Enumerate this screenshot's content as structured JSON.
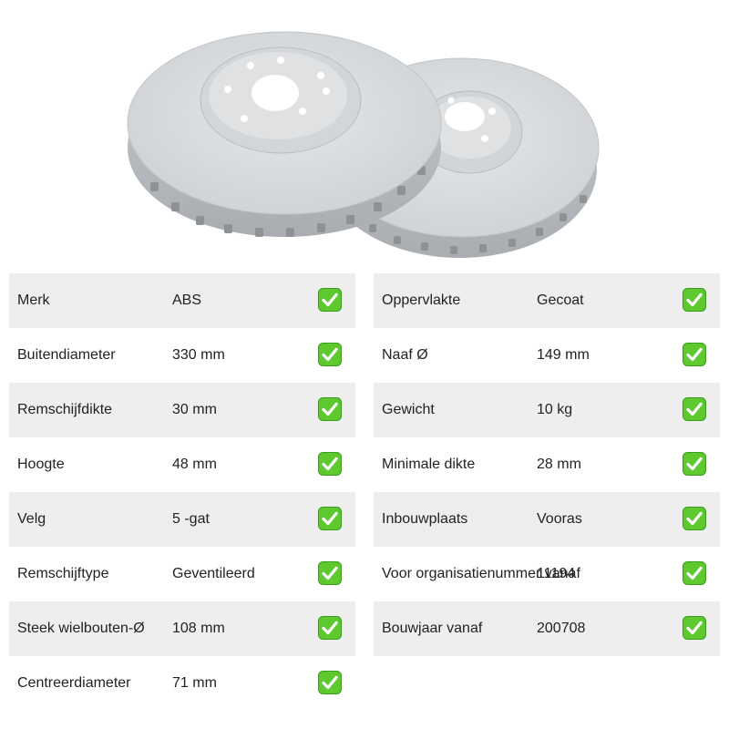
{
  "image": {
    "subject": "brake-disc-pair-icon",
    "disc_color": "#d6d9dc"
  },
  "colors": {
    "row_shade": "#eeeeee",
    "check_green": "#5ec82f",
    "check_border": "#3e9a1e"
  },
  "specs_left": [
    {
      "label": "Merk",
      "value": "ABS"
    },
    {
      "label": "Buitendiameter",
      "value": "330 mm"
    },
    {
      "label": "Remschijfdikte",
      "value": "30 mm"
    },
    {
      "label": "Hoogte",
      "value": "48 mm"
    },
    {
      "label": "Velg",
      "value": "5 -gat"
    },
    {
      "label": "Remschijftype",
      "value": "Geventileerd"
    },
    {
      "label": "Steek wielbouten-Ø",
      "value": "108 mm"
    },
    {
      "label": "Centreerdiameter",
      "value": "71 mm"
    }
  ],
  "specs_right": [
    {
      "label": "Oppervlakte",
      "value": "Gecoat"
    },
    {
      "label": "Naaf Ø",
      "value": "149 mm"
    },
    {
      "label": "Gewicht",
      "value": "10 kg"
    },
    {
      "label": "Minimale dikte",
      "value": "28 mm"
    },
    {
      "label": "Inbouwplaats",
      "value": "Vooras"
    },
    {
      "label": "Voor organisatienummer vanaf",
      "value": "11194"
    },
    {
      "label": "Bouwjaar vanaf",
      "value": "200708"
    }
  ]
}
